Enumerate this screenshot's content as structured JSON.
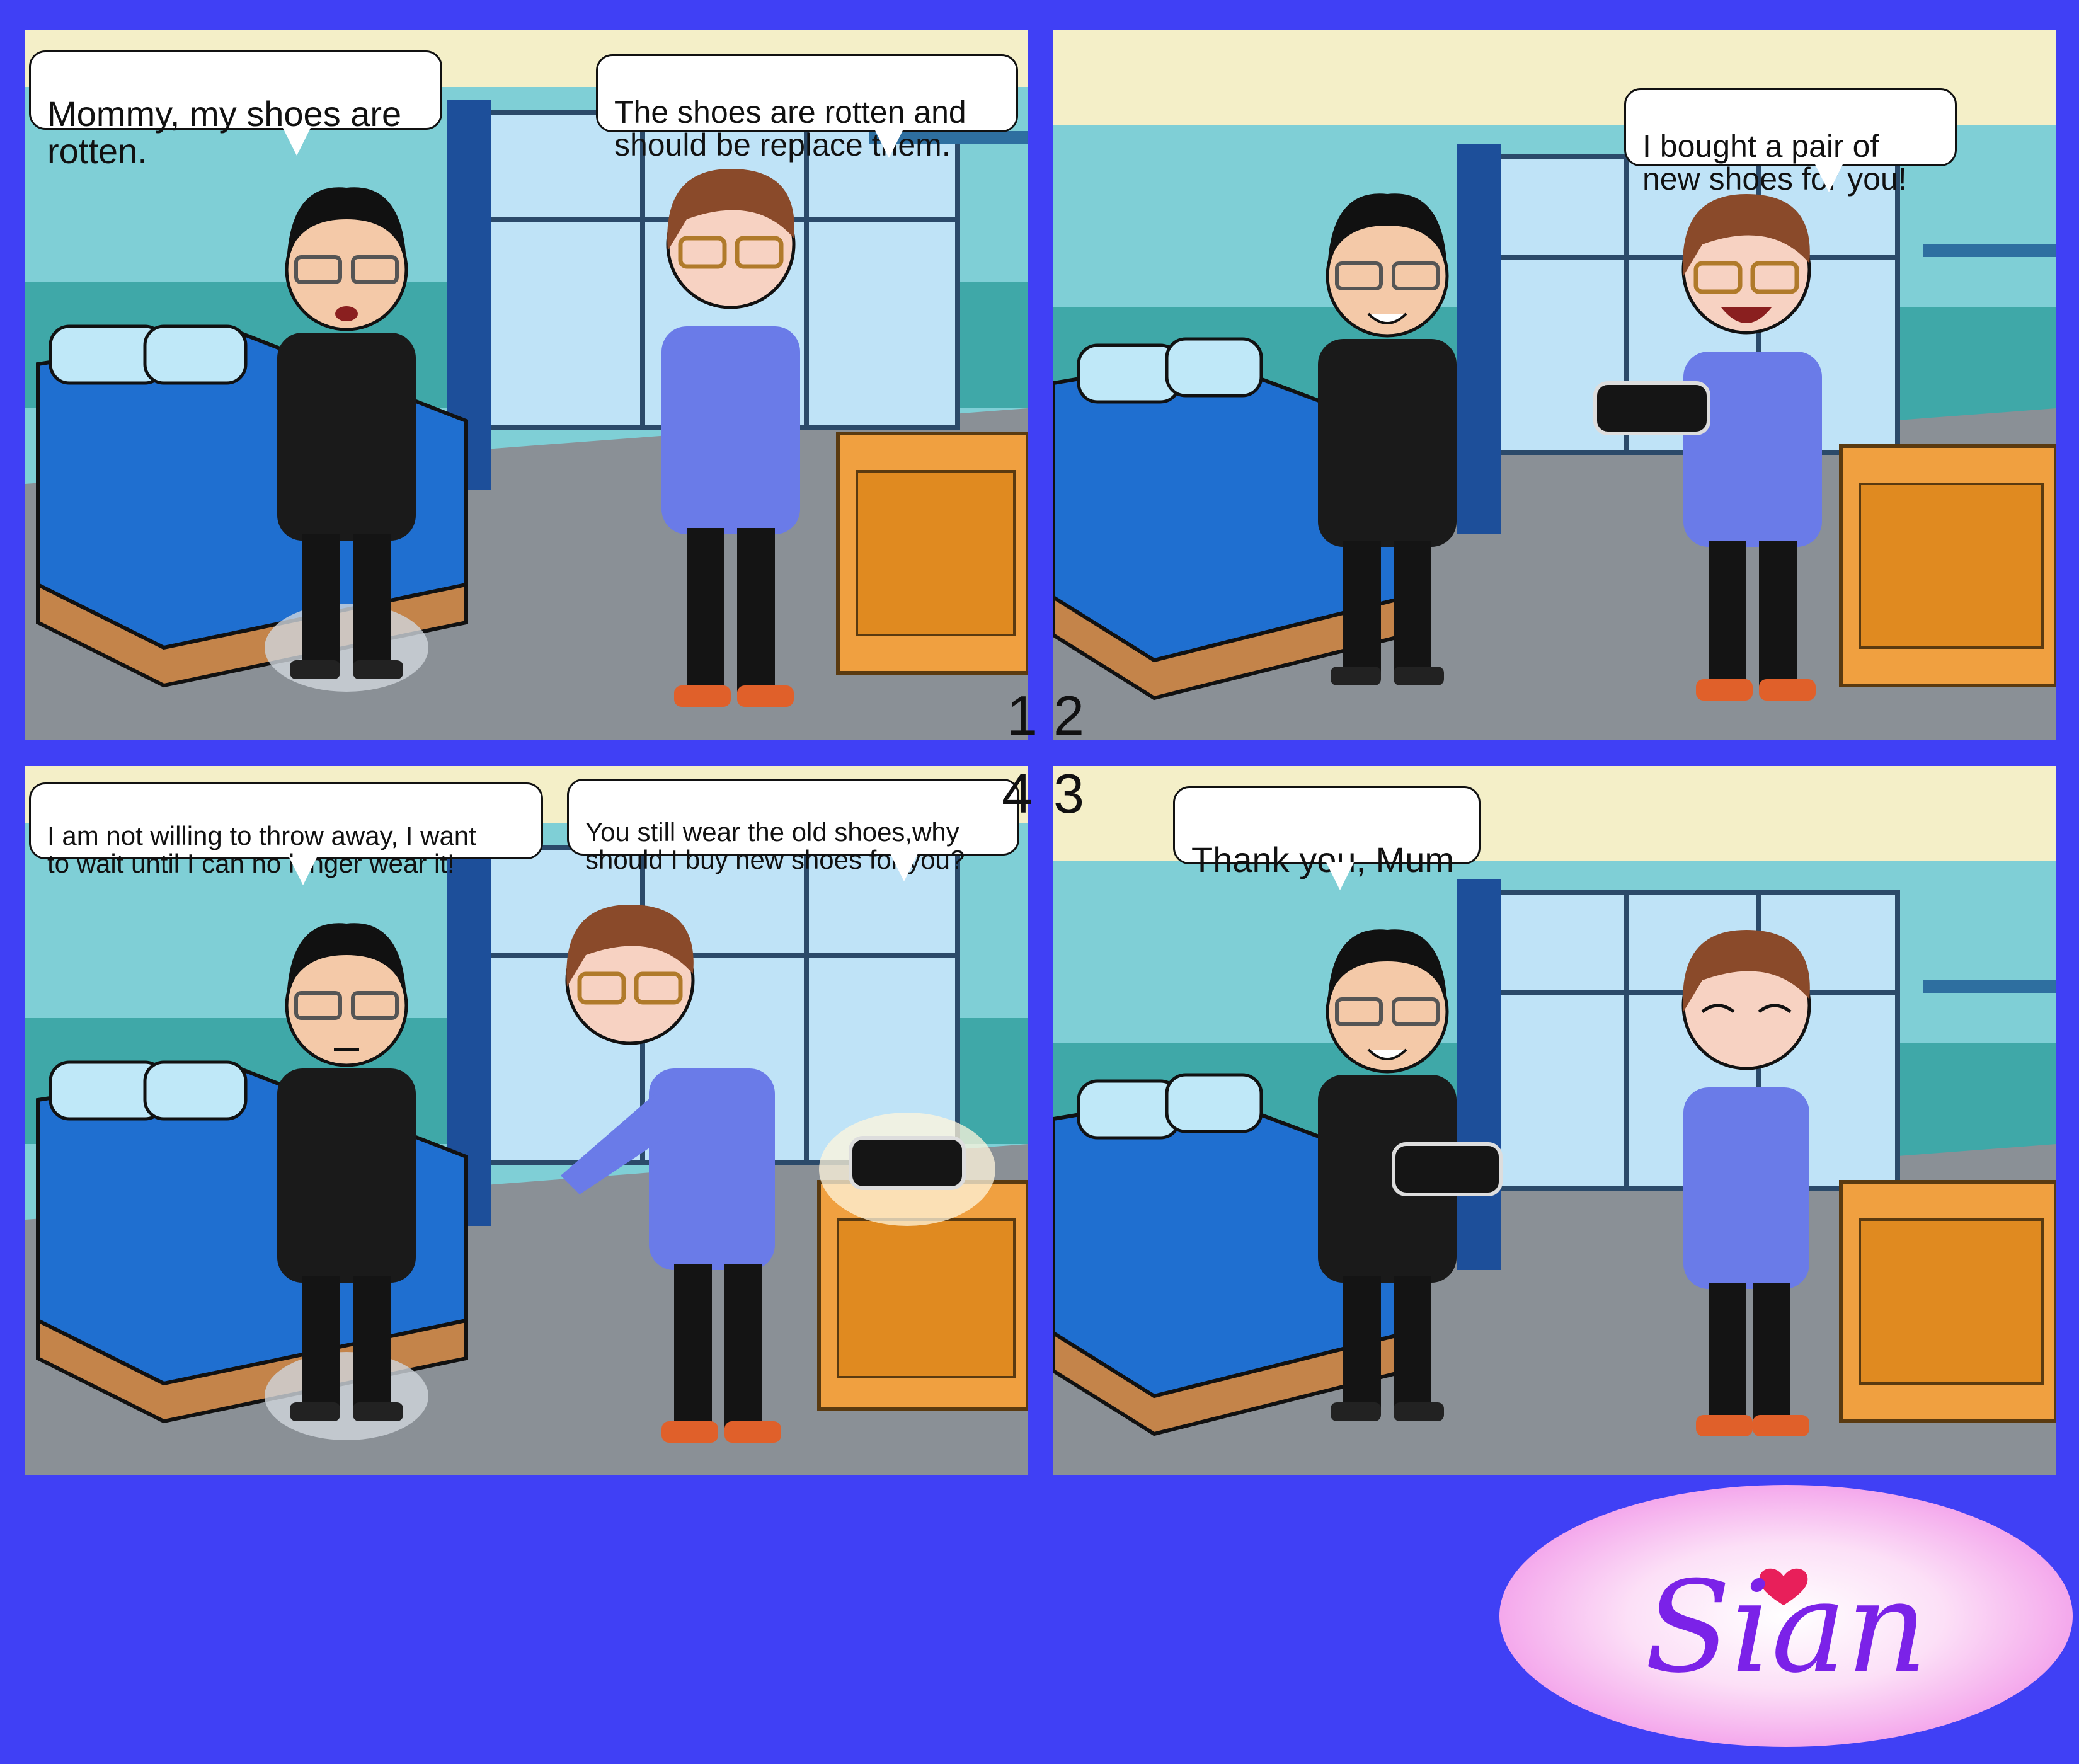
{
  "panels": [
    {
      "id": 1,
      "bubbles": [
        {
          "text": "Mommy, my shoes are\nrotten.",
          "speaker": "boy"
        },
        {
          "text": "The shoes are rotten and\nshould be replace them.",
          "speaker": "mom"
        }
      ]
    },
    {
      "id": 2,
      "bubbles": [
        {
          "text": "I bought a pair of\nnew shoes for you!",
          "speaker": "mom"
        }
      ]
    },
    {
      "id": 4,
      "bubbles": [
        {
          "text": "I am not willing to throw away, I want\nto wait until I can no longer wear it!",
          "speaker": "boy"
        },
        {
          "text": "You still wear the old shoes,why\nshould I buy new shoes for you?",
          "speaker": "mom"
        }
      ]
    },
    {
      "id": 3,
      "bubbles": [
        {
          "text": "Thank you, Mum",
          "speaker": "boy"
        }
      ]
    }
  ],
  "panel_numbers": [
    "1",
    "2",
    "4",
    "3"
  ],
  "logo": {
    "text": "Sian"
  },
  "colors": {
    "background": "#4040f5",
    "wall": "#7fcfd6",
    "floor": "#8a9096",
    "bedsheet": "#1f6fd0",
    "jacket_boy": "#1a1a1a",
    "hoodie_mom": "#6a7be8",
    "logo_text": "#7b22e8",
    "logo_bg": "#f9c4f1"
  }
}
